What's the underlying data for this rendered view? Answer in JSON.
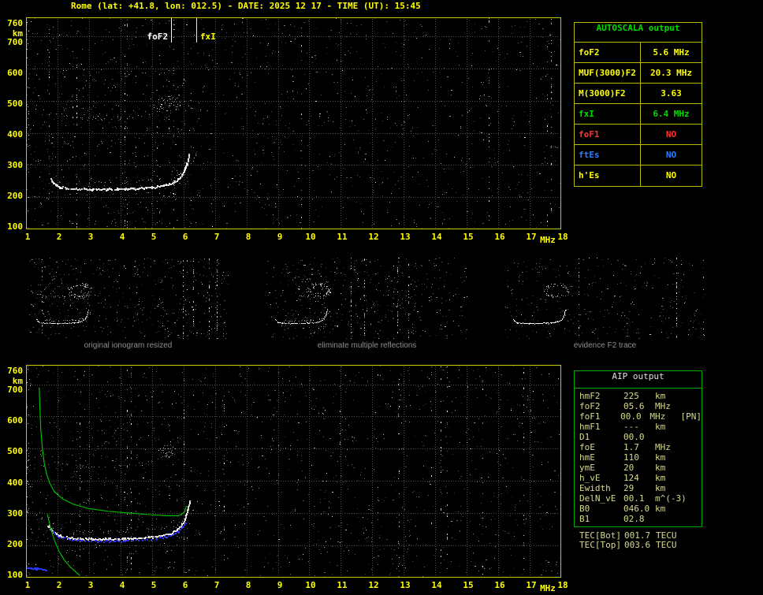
{
  "title": "Rome (lat: +41.8, lon: 012.5) - DATE: 2025 12 17 - TIME (UT): 15:45",
  "colors": {
    "background": "#000000",
    "title": "#ffff00",
    "axis_label": "#ffff00",
    "plot_border": "#c9c900",
    "grid": "#52523e",
    "trace_white": "#ffffff",
    "profile_green": "#00bb00",
    "trace_blue": "#3333ff",
    "autoscala_border": "#b9b900",
    "autoscala_header_green": "#00dd00",
    "aip_border": "#00a800",
    "aip_text": "#d8d890",
    "caption_gray": "#8f8f8f"
  },
  "autoscala": {
    "header": "AUTOSCALA output",
    "rows": [
      {
        "label": "foF2",
        "value": "5.6 MHz",
        "color": "#ffff00"
      },
      {
        "label": "MUF(3000)F2",
        "value": "20.3 MHz",
        "color": "#ffff00"
      },
      {
        "label": "M(3000)F2",
        "value": "3.63",
        "color": "#ffff00"
      },
      {
        "label": "fxI",
        "value": "6.4 MHz",
        "color": "#00dd00"
      },
      {
        "label": "foF1",
        "value": "NO",
        "color": "#ff3333"
      },
      {
        "label": "ftEs",
        "value": "NO",
        "color": "#2f7fff"
      },
      {
        "label": "h'Es",
        "value": "NO",
        "color": "#ffff00"
      }
    ]
  },
  "thumbnails": [
    {
      "caption": "original ionogram resized"
    },
    {
      "caption": "eliminate multiple reflections"
    },
    {
      "caption": "evidence F2 trace"
    }
  ],
  "aip": {
    "header": "AIP output",
    "rows": [
      {
        "label": "hmF2",
        "value": "225",
        "unit": "km",
        "extra": ""
      },
      {
        "label": "foF2",
        "value": "05.6",
        "unit": "MHz",
        "extra": ""
      },
      {
        "label": "foF1",
        "value": "00.0",
        "unit": "MHz",
        "extra": "[PN]"
      },
      {
        "label": "hmF1",
        "value": "---",
        "unit": "km",
        "extra": ""
      },
      {
        "label": "D1",
        "value": "00.0",
        "unit": "",
        "extra": ""
      },
      {
        "label": "foE",
        "value": "1.7",
        "unit": "MHz",
        "extra": ""
      },
      {
        "label": "hmE",
        "value": "110",
        "unit": "km",
        "extra": ""
      },
      {
        "label": "ymE",
        "value": "20",
        "unit": "km",
        "extra": ""
      },
      {
        "label": "h_vE",
        "value": "124",
        "unit": "km",
        "extra": ""
      },
      {
        "label": "Ewidth",
        "value": "29",
        "unit": "km",
        "extra": ""
      },
      {
        "label": "DelN_vE",
        "value": "00.1",
        "unit": "m^(-3)",
        "extra": ""
      },
      {
        "label": "B0",
        "value": "046.0",
        "unit": "km",
        "extra": ""
      },
      {
        "label": "B1",
        "value": "02.8",
        "unit": "",
        "extra": ""
      }
    ],
    "tec_rows": [
      {
        "label": "TEC[Bot]",
        "value": "001.7",
        "unit": "TECU"
      },
      {
        "label": "TEC[Top]",
        "value": "003.6",
        "unit": "TECU"
      }
    ]
  },
  "chart_data": [
    {
      "id": "recorded_ionogram",
      "type": "scatter",
      "xlabel": "MHz",
      "ylabel": "km",
      "xlim": [
        1,
        18
      ],
      "ylim": [
        100,
        760
      ],
      "x_ticks": [
        1,
        2,
        3,
        4,
        5,
        6,
        7,
        8,
        9,
        10,
        11,
        12,
        13,
        14,
        15,
        16,
        17,
        18
      ],
      "y_ticks": [
        760,
        700,
        600,
        500,
        400,
        300,
        200,
        100
      ],
      "grid": true,
      "annotations": [
        {
          "label": "foF2",
          "x": 5.6,
          "color": "#ffffff",
          "side": "left"
        },
        {
          "label": "fxI",
          "x": 6.4,
          "color": "#ffff00",
          "side": "right"
        }
      ],
      "series": [
        {
          "name": "F2-trace",
          "style": "trace",
          "color": "#ffffff",
          "points": [
            [
              1.78,
              258
            ],
            [
              1.86,
              246
            ],
            [
              1.96,
              237
            ],
            [
              2.1,
              231
            ],
            [
              2.35,
              228
            ],
            [
              2.7,
              226
            ],
            [
              3.1,
              225
            ],
            [
              3.6,
              225
            ],
            [
              4.1,
              226
            ],
            [
              4.6,
              228
            ],
            [
              5.0,
              231
            ],
            [
              5.3,
              235
            ],
            [
              5.55,
              241
            ],
            [
              5.75,
              250
            ],
            [
              5.9,
              262
            ],
            [
              6.0,
              277
            ],
            [
              6.08,
              296
            ],
            [
              6.14,
              317
            ],
            [
              6.19,
              338
            ]
          ]
        },
        {
          "name": "X-mode",
          "style": "sparse",
          "color": "#d8d8d8",
          "points": [
            [
              2.5,
              248
            ],
            [
              3.0,
              246
            ],
            [
              3.6,
              245
            ],
            [
              4.2,
              246
            ],
            [
              4.8,
              250
            ],
            [
              5.3,
              256
            ],
            [
              5.7,
              264
            ],
            [
              5.95,
              276
            ],
            [
              6.15,
              292
            ],
            [
              6.3,
              313
            ],
            [
              6.42,
              338
            ]
          ]
        },
        {
          "name": "2nd-hop",
          "style": "sparse",
          "color": "#c0c0c0",
          "points": [
            [
              1.95,
              462
            ],
            [
              2.3,
              452
            ],
            [
              2.8,
              446
            ],
            [
              3.4,
              443
            ],
            [
              4.0,
              446
            ],
            [
              4.6,
              452
            ],
            [
              5.0,
              460
            ],
            [
              5.35,
              472
            ],
            [
              5.6,
              489
            ],
            [
              5.8,
              512
            ],
            [
              5.95,
              540
            ],
            [
              6.05,
              566
            ]
          ]
        },
        {
          "name": "oblique-1",
          "style": "sparse",
          "color": "#a8a8a8",
          "points": [
            [
              2.5,
              425
            ],
            [
              3.2,
              492
            ],
            [
              3.9,
              552
            ],
            [
              4.5,
              606
            ]
          ]
        },
        {
          "name": "oblique-2",
          "style": "sparse",
          "color": "#989898",
          "points": [
            [
              2.2,
              478
            ],
            [
              2.8,
              541
            ],
            [
              3.4,
              601
            ],
            [
              3.7,
              629
            ]
          ]
        }
      ]
    },
    {
      "id": "autoscaled_ionogram",
      "type": "scatter",
      "xlabel": "MHz",
      "ylabel": "km",
      "xlim": [
        1,
        18
      ],
      "ylim": [
        100,
        760
      ],
      "x_ticks": [
        1,
        2,
        3,
        4,
        5,
        6,
        7,
        8,
        9,
        10,
        11,
        12,
        13,
        14,
        15,
        16,
        17,
        18
      ],
      "y_ticks": [
        760,
        700,
        600,
        500,
        400,
        300,
        200,
        100
      ],
      "grid": true,
      "annotations": [],
      "series": [
        {
          "name": "F2-trace",
          "style": "trace",
          "color": "#ffffff",
          "points": [
            [
              1.7,
              262
            ],
            [
              1.8,
              248
            ],
            [
              1.95,
              236
            ],
            [
              2.1,
              229
            ],
            [
              2.35,
              224
            ],
            [
              2.7,
              221
            ],
            [
              3.1,
              220
            ],
            [
              3.6,
              220
            ],
            [
              4.1,
              221
            ],
            [
              4.6,
              223
            ],
            [
              5.0,
              226
            ],
            [
              5.3,
              230
            ],
            [
              5.55,
              236
            ],
            [
              5.75,
              246
            ],
            [
              5.9,
              258
            ],
            [
              6.0,
              273
            ],
            [
              6.08,
              292
            ],
            [
              6.14,
              313
            ],
            [
              6.19,
              335
            ]
          ]
        },
        {
          "name": "X-mode",
          "style": "sparse",
          "color": "#cccccc",
          "points": [
            [
              2.5,
              244
            ],
            [
              3.0,
              242
            ],
            [
              3.6,
              241
            ],
            [
              4.2,
              242
            ],
            [
              4.8,
              246
            ],
            [
              5.3,
              252
            ],
            [
              5.7,
              260
            ],
            [
              5.95,
              272
            ],
            [
              6.15,
              288
            ],
            [
              6.3,
              309
            ],
            [
              6.42,
              334
            ]
          ]
        },
        {
          "name": "2nd-hop",
          "style": "sparse",
          "color": "#9a9a9a",
          "points": [
            [
              1.95,
              462
            ],
            [
              2.3,
              452
            ],
            [
              2.8,
              446
            ],
            [
              3.4,
              443
            ],
            [
              4.0,
              446
            ],
            [
              4.6,
              452
            ],
            [
              5.0,
              460
            ],
            [
              5.35,
              472
            ],
            [
              5.6,
              489
            ],
            [
              5.8,
              512
            ],
            [
              5.95,
              540
            ]
          ]
        },
        {
          "name": "oblique-1",
          "style": "sparse",
          "color": "#8a8a8a",
          "points": [
            [
              2.5,
              425
            ],
            [
              3.2,
              492
            ],
            [
              3.9,
              552
            ],
            [
              4.5,
              606
            ]
          ]
        },
        {
          "name": "scaled-trace-blue",
          "style": "dots",
          "color": "#3333ff",
          "points": [
            [
              1.72,
              252
            ],
            [
              1.9,
              238
            ],
            [
              2.1,
              226
            ],
            [
              2.4,
              219
            ],
            [
              2.8,
              215
            ],
            [
              3.2,
              214
            ],
            [
              3.7,
              214
            ],
            [
              4.2,
              215
            ],
            [
              4.7,
              218
            ],
            [
              5.1,
              221
            ],
            [
              5.4,
              226
            ],
            [
              5.65,
              233
            ],
            [
              5.85,
              244
            ],
            [
              5.98,
              259
            ],
            [
              6.05,
              272
            ]
          ]
        },
        {
          "name": "E-layer-blue",
          "style": "thick",
          "color": "#2233ee",
          "points": [
            [
              1.02,
              131
            ],
            [
              1.3,
              128
            ],
            [
              1.62,
              125
            ]
          ]
        },
        {
          "name": "profile-green",
          "style": "line",
          "color": "#00bb00",
          "points": [
            [
              1.42,
              690
            ],
            [
              1.44,
              628
            ],
            [
              1.47,
              560
            ],
            [
              1.52,
              500
            ],
            [
              1.58,
              455
            ],
            [
              1.66,
              420
            ],
            [
              1.76,
              392
            ],
            [
              1.9,
              367
            ],
            [
              2.15,
              345
            ],
            [
              2.5,
              328
            ],
            [
              3.0,
              314
            ],
            [
              3.6,
              306
            ],
            [
              4.3,
              300
            ],
            [
              5.0,
              295
            ],
            [
              5.5,
              292
            ],
            [
              5.85,
              292
            ],
            [
              6.02,
              302
            ],
            [
              6.1,
              322
            ]
          ]
        },
        {
          "name": "profile-valley-green",
          "style": "line",
          "color": "#00bb00",
          "points": [
            [
              1.68,
              297
            ],
            [
              1.78,
              254
            ],
            [
              1.9,
              217
            ],
            [
              2.05,
              182
            ],
            [
              2.22,
              154
            ],
            [
              2.42,
              132
            ],
            [
              2.6,
              116
            ],
            [
              2.72,
              106
            ]
          ]
        }
      ]
    }
  ]
}
